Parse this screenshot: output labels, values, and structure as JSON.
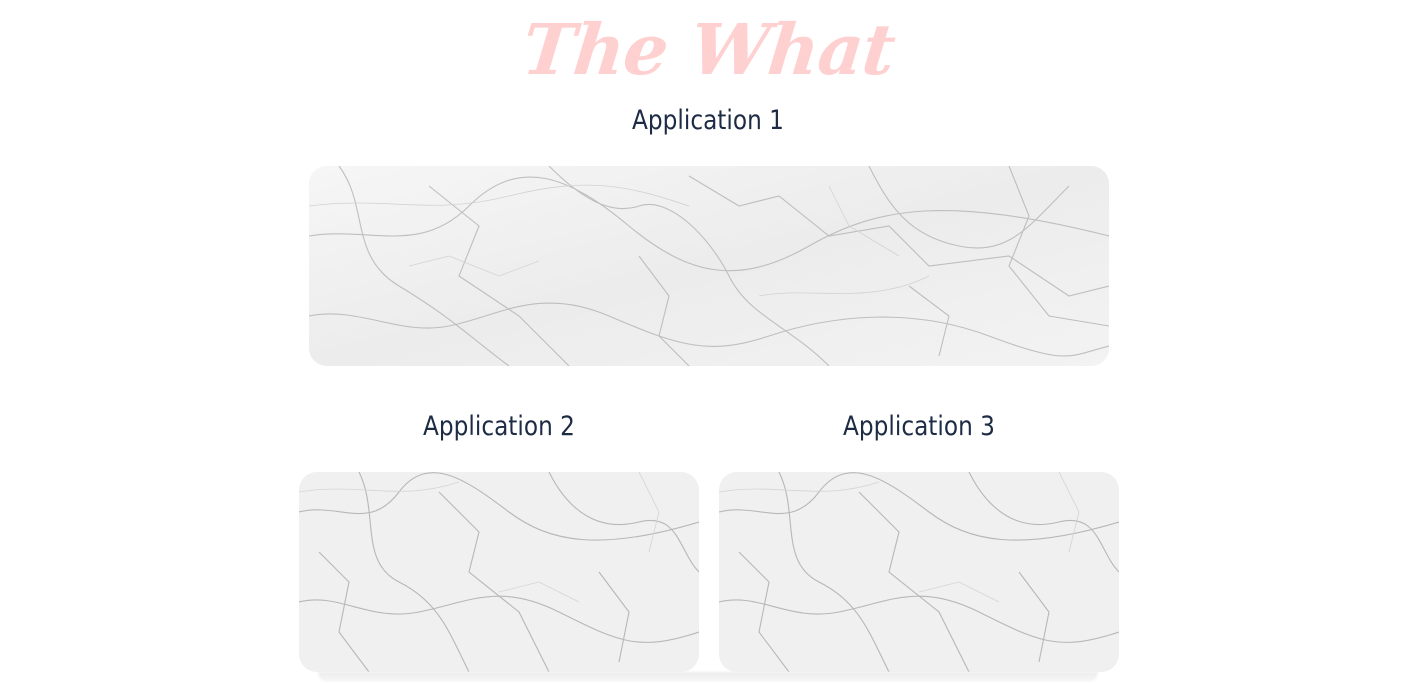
{
  "section": {
    "title": "The What",
    "title_color": "#ffd0d0",
    "label_color": "#1d2b45"
  },
  "applications": [
    {
      "label": "Application 1",
      "image": "marble-texture"
    },
    {
      "label": "Application 2",
      "image": "marble-texture"
    },
    {
      "label": "Application 3",
      "image": "marble-texture"
    }
  ]
}
